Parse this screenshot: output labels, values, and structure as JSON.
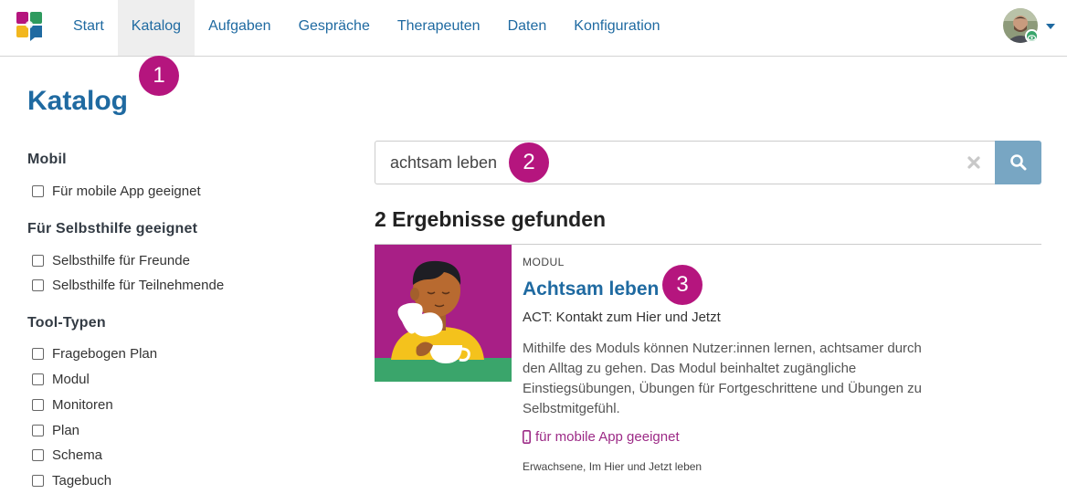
{
  "nav": {
    "items": [
      {
        "label": "Start",
        "active": false
      },
      {
        "label": "Katalog",
        "active": true
      },
      {
        "label": "Aufgaben",
        "active": false
      },
      {
        "label": "Gespräche",
        "active": false
      },
      {
        "label": "Therapeuten",
        "active": false
      },
      {
        "label": "Daten",
        "active": false
      },
      {
        "label": "Konfiguration",
        "active": false
      }
    ],
    "brand_colors": [
      "#2e9a5e",
      "#f2b71f",
      "#b5157e",
      "#1f6aa1"
    ]
  },
  "markers": {
    "one": "1",
    "two": "2",
    "three": "3"
  },
  "page": {
    "title": "Katalog"
  },
  "filters": {
    "groups": [
      {
        "heading": "Mobil",
        "options": [
          "Für mobile App geeignet"
        ]
      },
      {
        "heading": "Für Selbsthilfe geeignet",
        "options": [
          "Selbsthilfe für Freunde",
          "Selbsthilfe für Teilnehmende"
        ]
      },
      {
        "heading": "Tool-Typen",
        "options": [
          "Fragebogen Plan",
          "Modul",
          "Monitoren",
          "Plan",
          "Schema",
          "Tagebuch"
        ]
      }
    ]
  },
  "search": {
    "value": "achtsam leben"
  },
  "results": {
    "count_label": "2 Ergebnisse gefunden",
    "items": [
      {
        "kind": "MODUL",
        "title": "Achtsam leben",
        "subtitle": "ACT: Kontakt zum Hier und Jetzt",
        "description": "Mithilfe des Moduls können Nutzer:innen lernen, achtsamer durch den Alltag zu gehen. Das Modul beinhaltet zugängliche Einstiegsübungen, Übungen für Fortgeschrittene und Übungen zu Selbstmitgefühl.",
        "mobile_label": "für mobile App geeignet",
        "tags": "Erwachsene, Im Hier und Jetzt leben"
      }
    ]
  },
  "colors": {
    "accent": "#1f6aa1",
    "marker": "#b5157e",
    "search_button": "#78a6c3",
    "mobile_tag": "#9c2a86"
  }
}
